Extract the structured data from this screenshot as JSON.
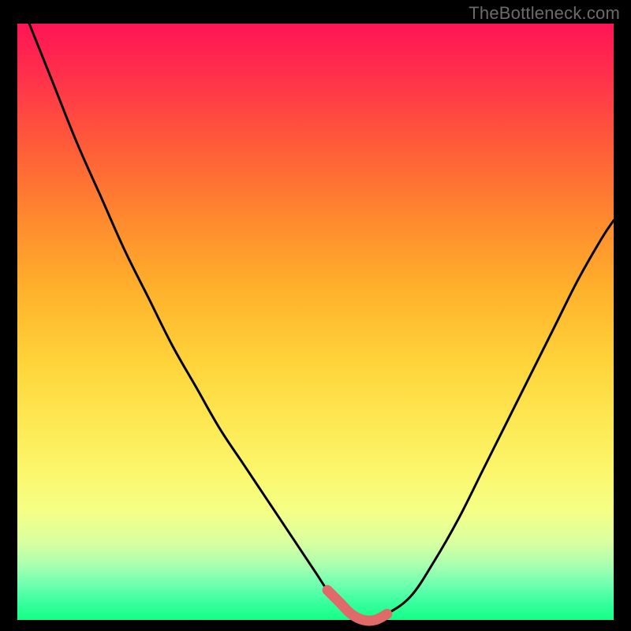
{
  "watermark": "TheBottleneck.com",
  "colors": {
    "background": "#000000",
    "curve_stroke": "#000000",
    "highlight_stroke": "#e06a6a",
    "gradient_top": "#ff1455",
    "gradient_bottom": "#14ff86"
  },
  "chart_data": {
    "type": "line",
    "title": "",
    "xlabel": "",
    "ylabel": "",
    "xlim": [
      0,
      100
    ],
    "ylim": [
      0,
      100
    ],
    "grid": false,
    "legend": false,
    "annotations": [
      "TheBottleneck.com"
    ],
    "series": [
      {
        "name": "bottleneck-curve",
        "x": [
          2,
          6,
          10,
          14,
          18,
          22,
          26,
          30,
          34,
          38,
          42,
          46,
          50,
          52,
          54,
          56,
          58,
          60,
          62,
          66,
          70,
          74,
          78,
          82,
          86,
          90,
          94,
          98,
          100
        ],
        "y": [
          100,
          90,
          80,
          71,
          62,
          54,
          46,
          39,
          32,
          26,
          20,
          14,
          8,
          5,
          3,
          1,
          0,
          0,
          1,
          4,
          10,
          17,
          25,
          33,
          41,
          49,
          57,
          64,
          67
        ]
      },
      {
        "name": "highlight-segment",
        "x": [
          52,
          54,
          56,
          58,
          60,
          62
        ],
        "y": [
          5,
          3,
          1,
          0,
          0,
          1
        ]
      }
    ]
  }
}
